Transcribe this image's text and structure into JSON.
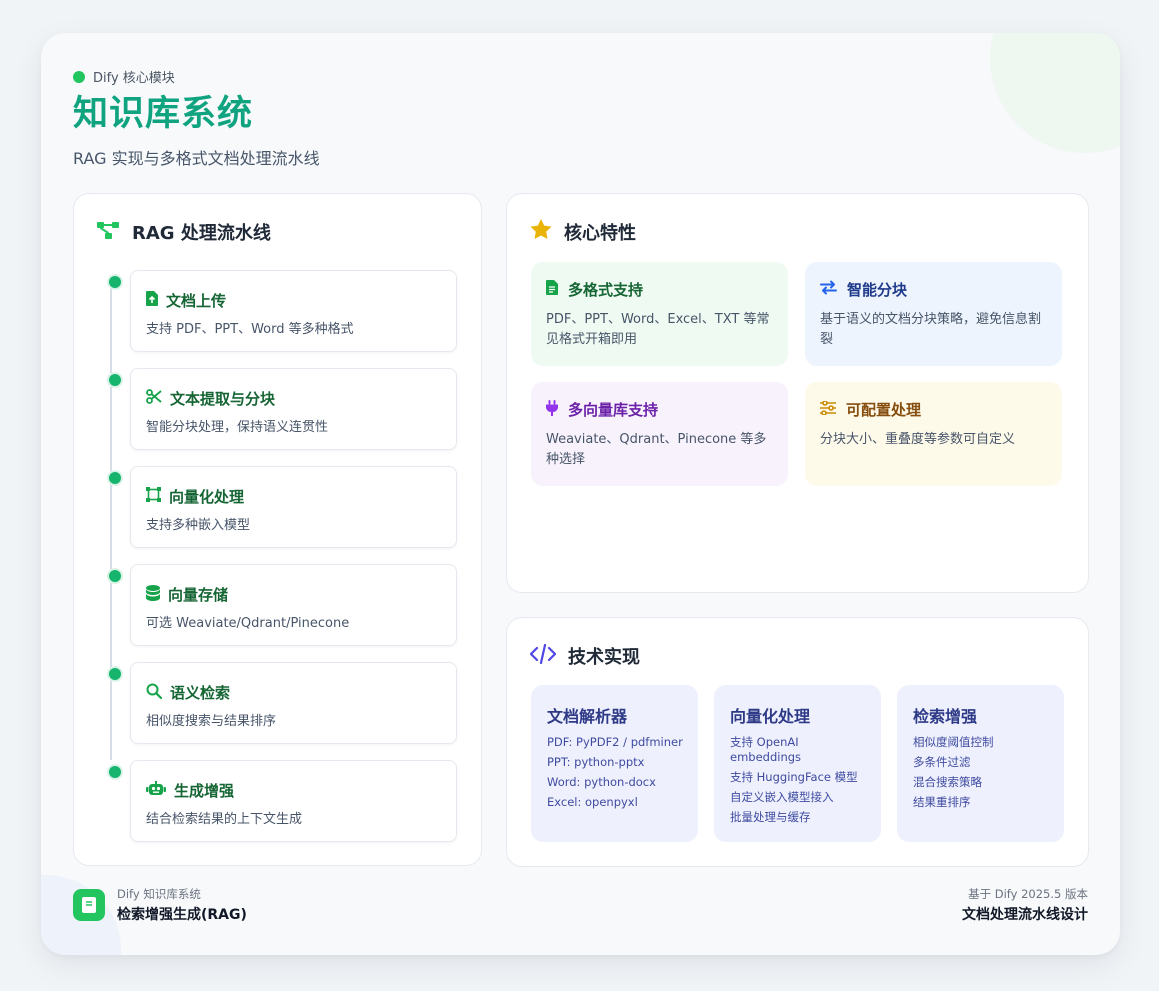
{
  "header": {
    "tag": "Dify 核心模块",
    "title": "知识库系统",
    "subtitle": "RAG 实现与多格式文档处理流水线"
  },
  "pipeline": {
    "title": "RAG 处理流水线",
    "steps": [
      {
        "icon": "file-upload-icon",
        "title": "文档上传",
        "desc": "支持 PDF、PPT、Word 等多种格式"
      },
      {
        "icon": "scissors-icon",
        "title": "文本提取与分块",
        "desc": "智能分块处理，保持语义连贯性"
      },
      {
        "icon": "vector-square-icon",
        "title": "向量化处理",
        "desc": "支持多种嵌入模型"
      },
      {
        "icon": "database-icon",
        "title": "向量存储",
        "desc": "可选 Weaviate/Qdrant/Pinecone"
      },
      {
        "icon": "search-icon",
        "title": "语义检索",
        "desc": "相似度搜索与结果排序"
      },
      {
        "icon": "robot-icon",
        "title": "生成增强",
        "desc": "结合检索结果的上下文生成"
      }
    ]
  },
  "features": {
    "title": "核心特性",
    "items": [
      {
        "icon": "file-icon",
        "title": "多格式支持",
        "desc": "PDF、PPT、Word、Excel、TXT 等常见格式开箱即用",
        "color": "#166534",
        "bg": "#effaf2"
      },
      {
        "icon": "exchange-icon",
        "title": "智能分块",
        "desc": "基于语义的文档分块策略，避免信息割裂",
        "color": "#1e3a8a",
        "bg": "#eef4fe"
      },
      {
        "icon": "plug-icon",
        "title": "多向量库支持",
        "desc": "Weaviate、Qdrant、Pinecone 等多种选择",
        "color": "#6b21a8",
        "bg": "#f8f2fd"
      },
      {
        "icon": "sliders-icon",
        "title": "可配置处理",
        "desc": "分块大小、重叠度等参数可自定义",
        "color": "#854d0e",
        "bg": "#fefaea"
      }
    ]
  },
  "tech": {
    "title": "技术实现",
    "cards": [
      {
        "title": "文档解析器",
        "items": [
          "PDF: PyPDF2 / pdfminer",
          "PPT: python-pptx",
          "Word: python-docx",
          "Excel: openpyxl"
        ]
      },
      {
        "title": "向量化处理",
        "items": [
          "支持 OpenAI embeddings",
          "支持 HuggingFace 模型",
          "自定义嵌入模型接入",
          "批量处理与缓存"
        ]
      },
      {
        "title": "检索增强",
        "items": [
          "相似度阈值控制",
          "多条件过滤",
          "混合搜索策略",
          "结果重排序"
        ]
      }
    ]
  },
  "footer": {
    "left_small": "Dify 知识库系统",
    "left_big": "检索增强生成(RAG)",
    "right_small": "基于 Dify 2025.5 版本",
    "right_big": "文档处理流水线设计"
  },
  "colors": {
    "accent": "#10a37f",
    "timeline_dot": "#16b46c",
    "star": "#eab308",
    "code": "#4f46e5"
  }
}
